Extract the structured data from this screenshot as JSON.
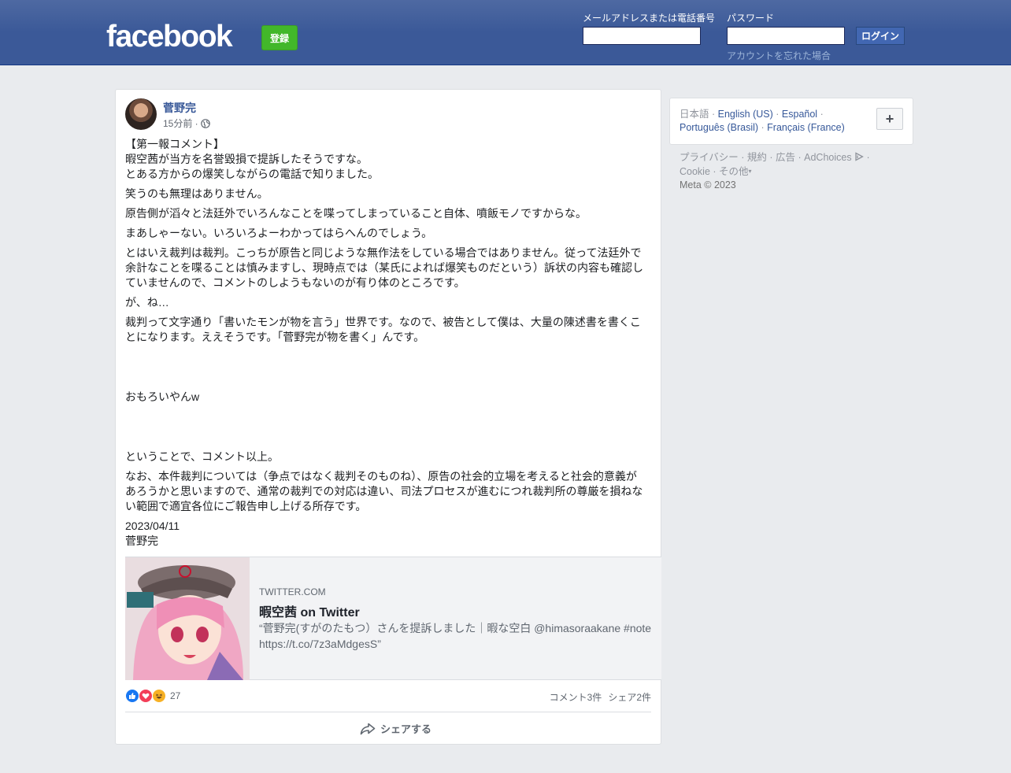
{
  "header": {
    "logo": "facebook",
    "signup_label": "登録",
    "email_label": "メールアドレスまたは電話番号",
    "email_value": "",
    "password_label": "パスワード",
    "password_value": "",
    "login_label": "ログイン",
    "forgot_label": "アカウントを忘れた場合"
  },
  "post": {
    "author": "菅野完",
    "time": "15分前 ·",
    "audience_icon": "globe-icon",
    "paragraphs": [
      "【第一報コメント】",
      "暇空茜が当方を名誉毀損で提訴したそうですな。",
      "とある方からの爆笑しながらの電話で知りました。",
      "笑うのも無理はありません。",
      "原告側が滔々と法廷外でいろんなことを喋ってしまっていること自体、噴飯モノですからな。",
      "まあしゃーない。いろいろよーわかってはらへんのでしょう。",
      "とはいえ裁判は裁判。こっちが原告と同じような無作法をしている場合ではありません。従って法廷外で余計なことを喋ることは慎みますし、現時点では（某氏によれば爆笑ものだという）訴状の内容も確認していませんので、コメントのしようもないのが有り体のところです。",
      "が、ね…",
      "裁判って文字通り「書いたモンが物を言う」世界です。なので、被告として僕は、大量の陳述書を書くことになります。ええそうです。「菅野完が物を書く」んです。",
      "おもろいやんw",
      "ということで、コメント以上。",
      "なお、本件裁判については（争点ではなく裁判そのものね）、原告の社会的立場を考えると社会的意義があろうかと思いますので、通常の裁判での対応は違い、司法プロセスが進むにつれ裁判所の尊厳を損ねない範囲で適宜各位にご報告申し上げる所存です。",
      "2023/04/11",
      "菅野完"
    ],
    "link_preview": {
      "domain": "TWITTER.COM",
      "title": "暇空茜 on Twitter",
      "description": "“菅野完(すがのたもつ）さんを提訴しました｜暇な空白 @himasoraakane #note https://t.co/7z3aMdgesS”"
    },
    "reactions": {
      "icons": [
        "like-icon",
        "love-icon",
        "haha-icon"
      ],
      "count": "27"
    },
    "comments_label": "コメント3件",
    "shares_label": "シェア2件",
    "share_action_label": "シェアする"
  },
  "sidebar": {
    "current_language": "日本語",
    "languages": [
      "English (US)",
      "Español",
      "Português (Brasil)",
      "Français (France)"
    ],
    "footer_links": [
      "プライバシー",
      "規約",
      "広告",
      "AdChoices",
      "Cookie",
      "その他"
    ],
    "copyright": "Meta © 2023"
  },
  "colors": {
    "header_blue": "#3b5998",
    "signup_green": "#42b72a",
    "link_blue": "#385898",
    "background": "#e9ebee"
  }
}
